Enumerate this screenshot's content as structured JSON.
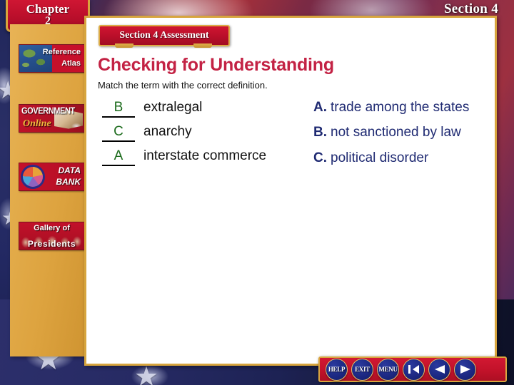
{
  "header": {
    "chapter_word": "Chapter",
    "chapter_number": "2",
    "section_label": "Section 4"
  },
  "sidebar": {
    "items": [
      {
        "id": "reference-atlas",
        "line1": "Reference",
        "line2": "Atlas",
        "icon": "globe-map-icon"
      },
      {
        "id": "government-online",
        "line1": "GOVERNMENT",
        "line2": "Online",
        "icon": "open-book-icon"
      },
      {
        "id": "data-bank",
        "line1": "DATA",
        "line2": "BANK",
        "icon": "pie-chart-icon"
      },
      {
        "id": "gallery-of-presidents",
        "line1": "Gallery of",
        "line2": "Presidents",
        "icon": "presidents-portraits-icon"
      }
    ]
  },
  "main": {
    "banner": "Section 4 Assessment",
    "title": "Checking for Understanding",
    "instruction": "Match the term with the correct definition.",
    "terms": [
      {
        "answer": "B",
        "term": "extralegal"
      },
      {
        "answer": "C",
        "term": "anarchy"
      },
      {
        "answer": "A",
        "term": "interstate commerce"
      }
    ],
    "definitions": [
      {
        "letter": "A.",
        "text": "trade among the states"
      },
      {
        "letter": "B.",
        "text": "not sanctioned by law"
      },
      {
        "letter": "C.",
        "text": "political disorder"
      }
    ]
  },
  "navbar": {
    "buttons": [
      {
        "id": "help",
        "label": "HELP",
        "type": "text"
      },
      {
        "id": "exit",
        "label": "EXIT",
        "type": "text"
      },
      {
        "id": "menu",
        "label": "MENU",
        "type": "text"
      },
      {
        "id": "first",
        "label": "",
        "type": "icon",
        "icon": "first-page-arrow-icon"
      },
      {
        "id": "back",
        "label": "",
        "type": "icon",
        "icon": "back-arrow-icon"
      },
      {
        "id": "forward",
        "label": "",
        "type": "icon",
        "icon": "forward-arrow-icon"
      }
    ]
  },
  "colors": {
    "title_red": "#C32244",
    "answer_green": "#1C6B1C",
    "definition_navy": "#1F2A72",
    "banner_red": "#BB0F2A",
    "gold": "#D7A53E"
  }
}
